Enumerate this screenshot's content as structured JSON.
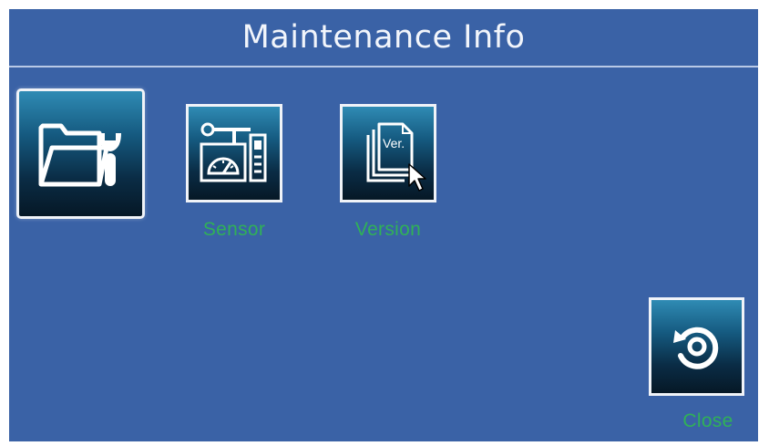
{
  "window": {
    "title": "Maintenance Info"
  },
  "menu": {
    "items": [
      {
        "id": "maintenance",
        "label": "",
        "icon": "folder-wrench-icon",
        "selected": true
      },
      {
        "id": "sensor",
        "label": "Sensor",
        "icon": "sensor-gauge-icon",
        "selected": false
      },
      {
        "id": "version",
        "label": "Version",
        "icon": "version-document-icon",
        "selected": false
      }
    ]
  },
  "close": {
    "label": "Close",
    "icon": "back-return-icon"
  },
  "icon_labels": {
    "version_badge": "Ver."
  },
  "colors": {
    "background": "#3a62a6",
    "tile_border": "#f0f3f8",
    "label_green": "#2fbf4a",
    "title_text": "#f2f5fb"
  }
}
